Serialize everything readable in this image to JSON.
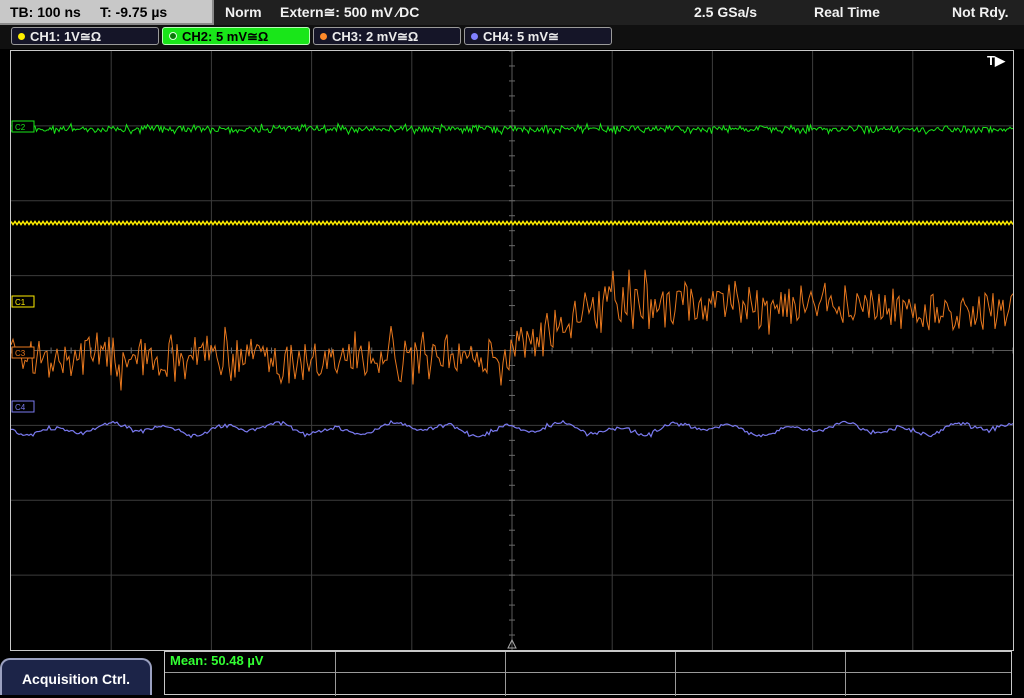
{
  "status": {
    "timebase": "TB: 100 ns",
    "trigger_time": "T: -9.75 µs",
    "acq_mode": "Norm",
    "trigger_source": "Extern≅: 500 mV ⁄DC",
    "sample_rate": "2.5 GSa/s",
    "mode": "Real Time",
    "state": "Not Rdy."
  },
  "channels": [
    {
      "label": "CH1: 1V≅Ω",
      "color": "#ffee00"
    },
    {
      "label": "CH2: 5 mV≅Ω",
      "color": "#19e619"
    },
    {
      "label": "CH3: 2 mV≅Ω",
      "color": "#ff8a2a"
    },
    {
      "label": "CH4: 5 mV≅",
      "color": "#8080ff"
    }
  ],
  "trace_markers": {
    "c2": "C2",
    "c1": "C1",
    "c3": "C3",
    "c4": "C4"
  },
  "trigger_marker": "T▶",
  "colors": {
    "ch1": "#ffee00",
    "ch2": "#19e619",
    "ch3": "#e8781e",
    "ch4": "#7a7af0",
    "grid": "#3c3c3c"
  },
  "buttons": {
    "acquisition": "Acquisition Ctrl."
  },
  "measurement": {
    "mean": "Mean: 50.48 µV"
  }
}
